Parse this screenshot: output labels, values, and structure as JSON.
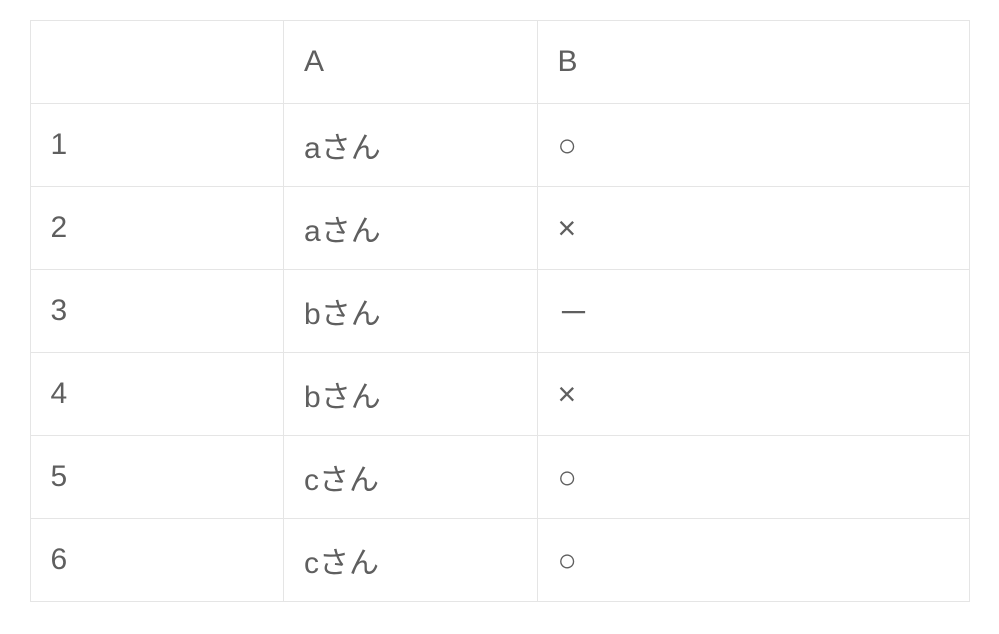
{
  "table": {
    "headers": {
      "rownum": "",
      "colA": "A",
      "colB": "B"
    },
    "rows": [
      {
        "num": "1",
        "a": "aさん",
        "b": "○"
      },
      {
        "num": "2",
        "a": "aさん",
        "b": "×"
      },
      {
        "num": "3",
        "a": "bさん",
        "b": "－"
      },
      {
        "num": "4",
        "a": "bさん",
        "b": "×"
      },
      {
        "num": "5",
        "a": "cさん",
        "b": "○"
      },
      {
        "num": "6",
        "a": "cさん",
        "b": "○"
      }
    ]
  }
}
